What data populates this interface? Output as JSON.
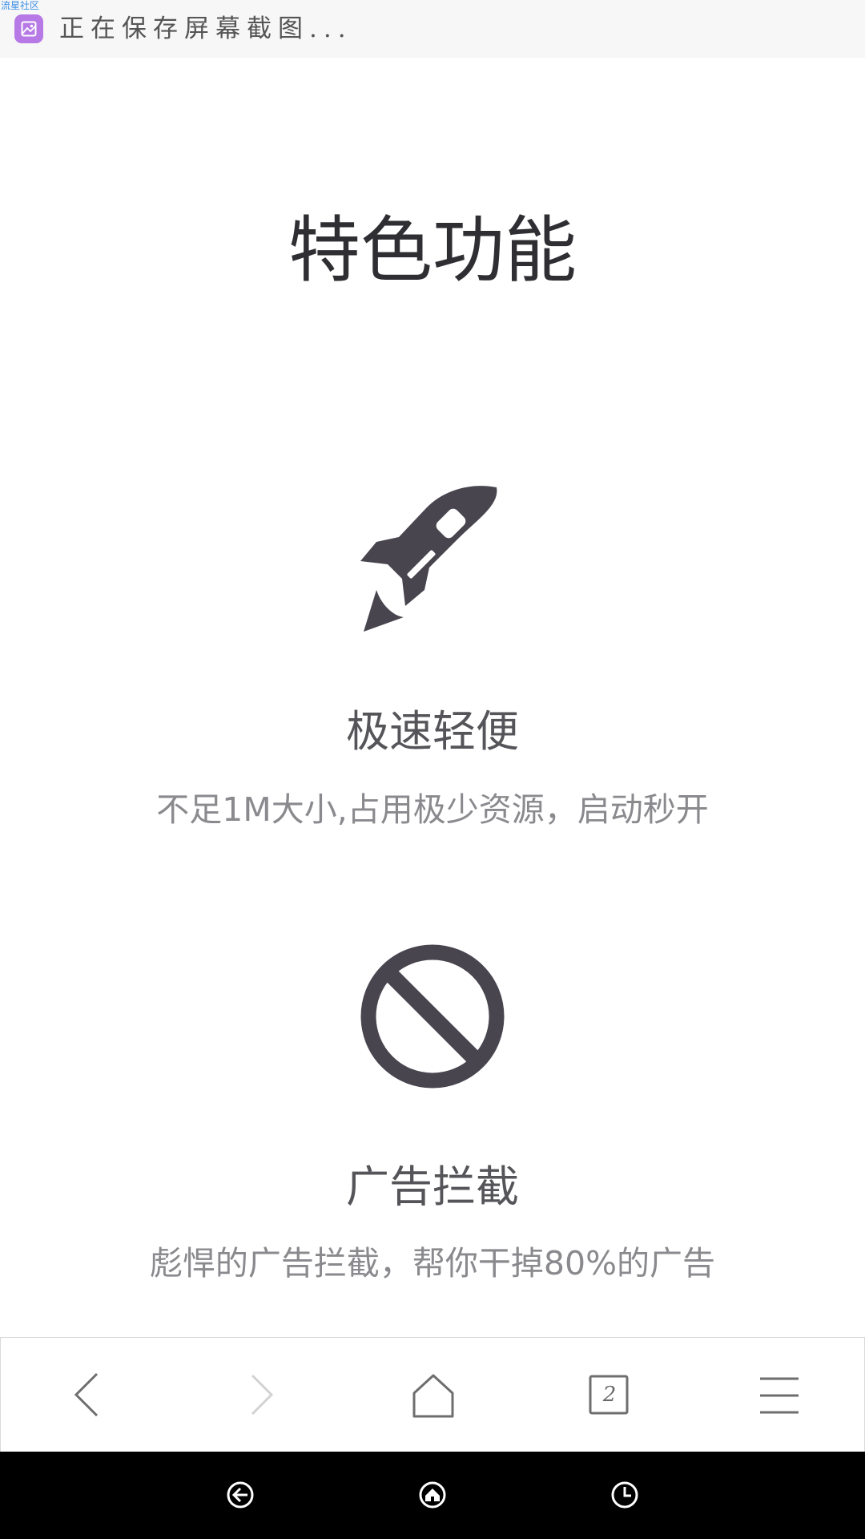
{
  "status_bar": {
    "watermark": "流星社区",
    "notification_text": "正在保存屏幕截图...",
    "notification_icon": "screenshot-icon"
  },
  "page": {
    "title": "特色功能"
  },
  "features": [
    {
      "icon": "rocket-icon",
      "title": "极速轻便",
      "description": "不足1M大小,占用极少资源，启动秒开"
    },
    {
      "icon": "ban-icon",
      "title": "广告拦截",
      "description": "彪悍的广告拦截，帮你干掉80%的广告"
    }
  ],
  "toolbar": {
    "back_icon": "chevron-left-icon",
    "forward_icon": "chevron-right-icon",
    "home_icon": "home-icon",
    "tab_count": "2",
    "menu_icon": "hamburger-menu-icon"
  },
  "system_nav": {
    "back_icon": "nav-back-icon",
    "home_icon": "nav-home-icon",
    "recent_icon": "nav-recent-icon"
  },
  "colors": {
    "icon_dark": "#48454f",
    "title": "#2f2f33",
    "feature_title": "#555459",
    "feature_desc": "#8a8a8e",
    "notification_icon_bg": "#b679e6",
    "watermark": "#3a8ee6"
  }
}
